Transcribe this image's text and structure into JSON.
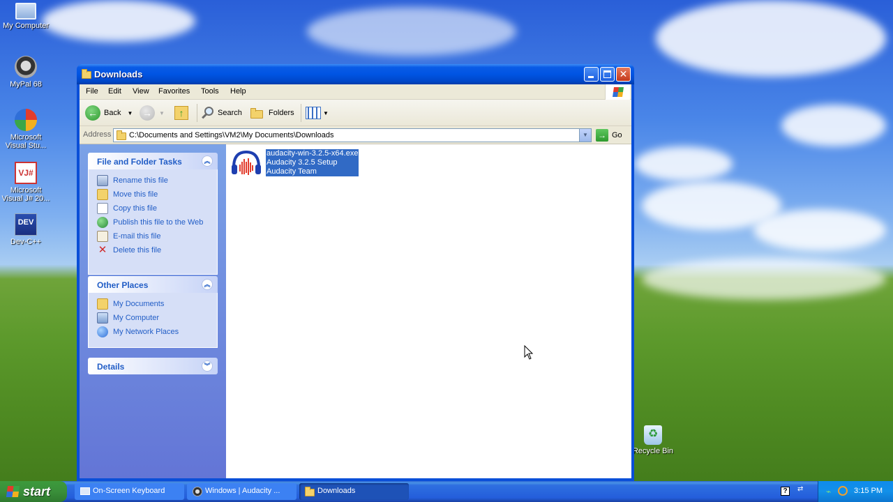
{
  "desktop": {
    "icons": [
      {
        "label": "My Computer"
      },
      {
        "label": "MyPal 68"
      },
      {
        "label": "Microsoft Visual Stu..."
      },
      {
        "label": "Microsoft Visual J# 20..."
      },
      {
        "label": "Dev-C++"
      },
      {
        "label": "Recycle Bin"
      }
    ]
  },
  "window": {
    "title": "Downloads",
    "menu": [
      "File",
      "Edit",
      "View",
      "Favorites",
      "Tools",
      "Help"
    ],
    "toolbar": {
      "back_label": "Back",
      "search_label": "Search",
      "folders_label": "Folders"
    },
    "address": {
      "label": "Address",
      "value": "C:\\Documents and Settings\\VM2\\My Documents\\Downloads",
      "go_label": "Go"
    },
    "left_pane": {
      "file_tasks": {
        "title": "File and Folder Tasks",
        "items": [
          "Rename this file",
          "Move this file",
          "Copy this file",
          "Publish this file to the Web",
          "E-mail this file",
          "Delete this file"
        ]
      },
      "other_places": {
        "title": "Other Places",
        "items": [
          "My Documents",
          "My Computer",
          "My Network Places"
        ]
      },
      "details": {
        "title": "Details"
      }
    },
    "file": {
      "name": "audacity-win-3.2.5-x64.exe",
      "description": "Audacity 3.2.5 Setup",
      "company": "Audacity Team"
    }
  },
  "taskbar": {
    "start_label": "start",
    "buttons": [
      "On-Screen Keyboard",
      "Windows | Audacity ...",
      "Downloads"
    ],
    "clock": "3:15 PM"
  },
  "colors": {
    "title_blue": "#0054e3",
    "task_link": "#215dc6",
    "selection": "#316ac5",
    "start_green": "#3a8f3a"
  }
}
